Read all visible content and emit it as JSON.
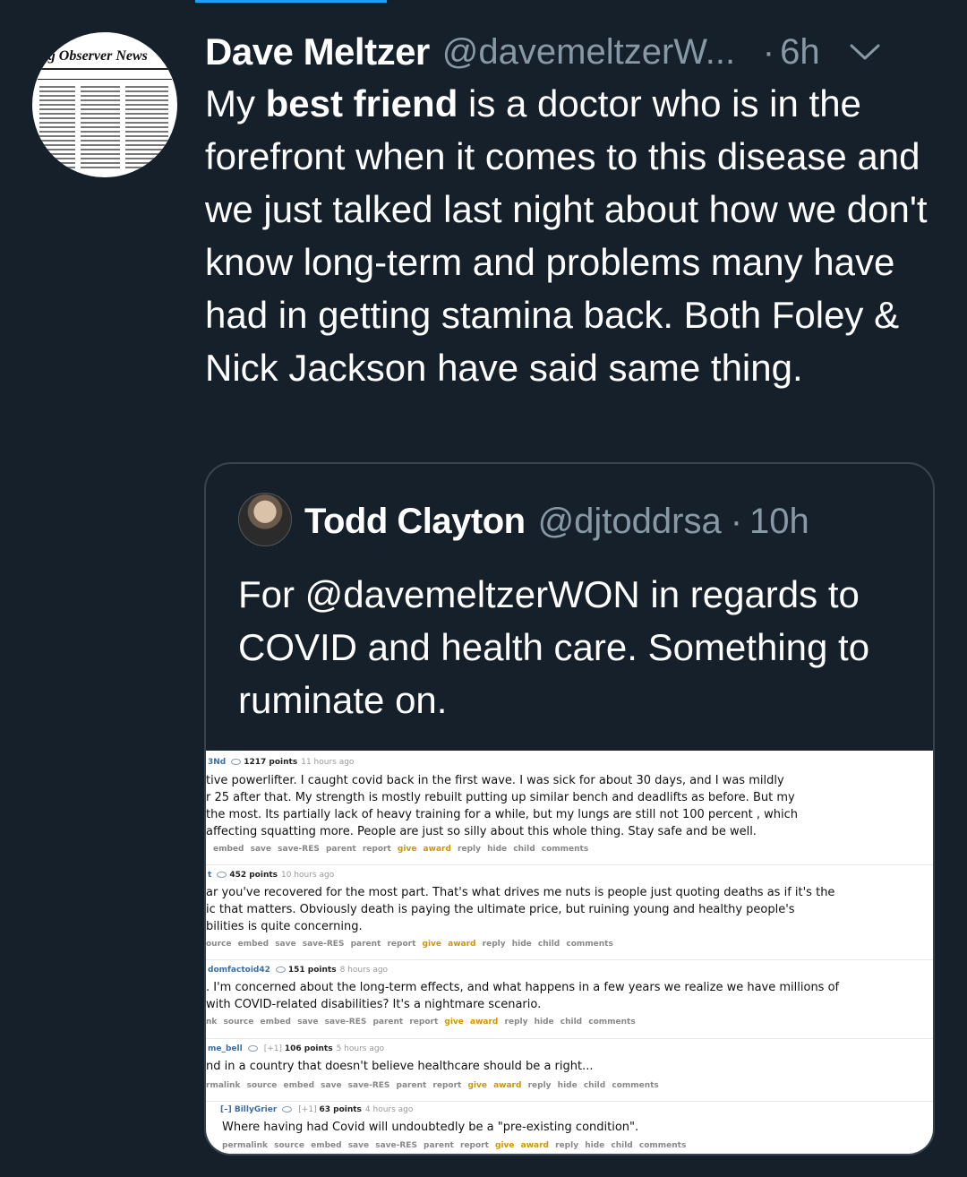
{
  "tweet": {
    "author": {
      "display_name": "Dave Meltzer",
      "handle": "@davemeltzerW...",
      "avatar_masthead": "ling Observer News"
    },
    "separator": "·",
    "time": "6h",
    "text_before": "My ",
    "text_bold": "best friend",
    "text_after": " is a doctor who is in the forefront when it comes to this disease and we just talked last night about how we don't know long-term and problems many have had in getting stamina back. Both Foley & Nick Jackson have said same thing.",
    "icons": {
      "menu": "chevron-down-icon"
    }
  },
  "quote": {
    "author": {
      "display_name": "Todd Clayton",
      "handle": "@djtoddrsa"
    },
    "separator": "·",
    "time": "10h",
    "text": "For @davemeltzerWON in regards to COVID and health care. Something to ruminate on.",
    "image": {
      "comments": [
        {
          "user": "3Nd",
          "points": "1217 points",
          "ago": "11 hours ago",
          "lines": [
            "tive powerlifter. I caught covid back in the first wave. I was sick for about 30 days, and I was mildly",
            "r 25 after that. My strength is mostly rebuilt putting up similar bench and deadlifts as before. But my",
            "the most. Its partially lack of heavy training for a while, but my lungs are still not 100 percent , which",
            "affecting squatting more. People are just so silly about this whole thing. Stay safe and be well."
          ],
          "actions_pre": "embed save save-RES parent report",
          "award": "give award",
          "actions_post": "reply hide child comments"
        },
        {
          "user": "t",
          "points": "452 points",
          "ago": "10 hours ago",
          "lines": [
            "ar you've recovered for the most part. That's what drives me nuts is people just quoting deaths as if it's the",
            "ic that matters. Obviously death is paying the ultimate price, but ruining young and healthy people's",
            "bilities is quite concerning."
          ],
          "actions_pre": "ource embed save save-RES parent report",
          "award": "give award",
          "actions_post": "reply hide child comments"
        },
        {
          "user": "domfactoid42",
          "points": "151 points",
          "ago": "8 hours ago",
          "lines": [
            ". I'm concerned about the long-term effects, and what happens in a few years we realize we have millions of",
            "with COVID-related disabilities? It's a nightmare scenario."
          ],
          "actions_pre": "nk source embed save save-RES parent report",
          "award": "give award",
          "actions_post": "reply hide child comments"
        },
        {
          "user": "me_bell",
          "vote_extra": "[+1]",
          "points": "106 points",
          "ago": "5 hours ago",
          "lines": [
            "nd in a country that doesn't believe healthcare should be a right..."
          ],
          "actions_pre": "rmalink source embed save save-RES parent report",
          "award": "give award",
          "actions_post": "reply hide child comments"
        },
        {
          "user": "[–] BillyGrier",
          "vote_extra": "[+1]",
          "points": "63 points",
          "ago": "4 hours ago",
          "lines": [
            "Where having had Covid will undoubtedly be a \"pre-existing condition\"."
          ],
          "actions_pre": "permalink source embed save save-RES parent report",
          "award": "give award",
          "actions_post": "reply hide child comments"
        }
      ]
    }
  }
}
